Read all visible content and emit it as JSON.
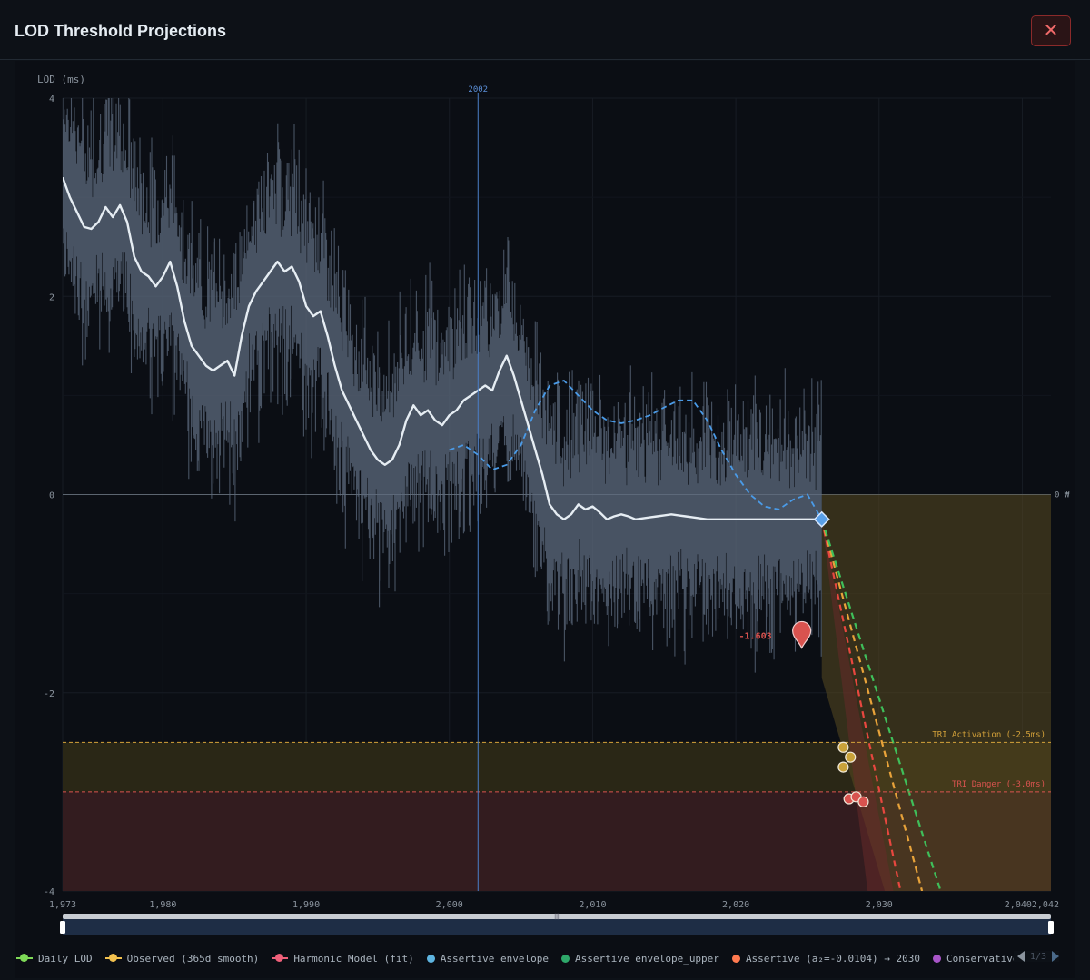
{
  "header": {
    "title": "LOD Threshold Projections",
    "close_icon": "close-icon",
    "close_color": "#f06a6a"
  },
  "chart_data": {
    "type": "line",
    "ylabel": "LOD (ms)",
    "xlim": [
      1973,
      2042
    ],
    "ylim": [
      -4,
      4
    ],
    "x_ticks": [
      "1,973",
      "1,980",
      "1,990",
      "2,000",
      "2,010",
      "2,020",
      "2,030",
      "2,0402,042"
    ],
    "x_tick_values": [
      1973,
      1980,
      1990,
      2000,
      2010,
      2020,
      2030,
      2040
    ],
    "y_ticks": [
      "4",
      "2",
      "0",
      "-2",
      "-4"
    ],
    "y_tick_values": [
      4,
      2,
      0,
      -2,
      -4
    ],
    "grid": true,
    "zero_line_label": "0 ₩",
    "vertical_marker": {
      "x": 2002,
      "label": "2002",
      "color": "#4a7fc8"
    },
    "thresholds": [
      {
        "name": "TRI Activation (-2.5ms)",
        "y": -2.5,
        "color": "#d4a23a",
        "band_color": "#2a2716"
      },
      {
        "name": "TRI Danger (-3.0ms)",
        "y": -3.0,
        "color": "#d9534f",
        "band_color": "#331c1f"
      }
    ],
    "min_marker": {
      "x": 2024.6,
      "y": -1.42,
      "label": "-1.603",
      "color": "#d9534f"
    },
    "projection_start": {
      "x": 2026.0,
      "y": -0.25
    },
    "series": [
      {
        "name": "Daily LOD",
        "legend_color": "#7ed957",
        "color": "#5d6b7d"
      },
      {
        "name": "Observed (365d smooth)",
        "legend_color": "#f2c14e",
        "color": "#e6edf3",
        "x": [
          1973.0,
          1973.5,
          1974,
          1974.5,
          1975,
          1975.5,
          1976,
          1976.5,
          1977,
          1977.5,
          1978,
          1978.5,
          1979,
          1979.5,
          1980,
          1980.5,
          1981,
          1981.5,
          1982,
          1982.5,
          1983,
          1983.5,
          1984,
          1984.5,
          1985,
          1985.5,
          1986,
          1986.5,
          1987,
          1987.5,
          1988,
          1988.5,
          1989,
          1989.5,
          1990,
          1990.5,
          1991,
          1991.5,
          1992,
          1992.5,
          1993,
          1993.5,
          1994,
          1994.5,
          1995,
          1995.5,
          1996,
          1996.5,
          1997,
          1997.5,
          1998,
          1998.5,
          1999,
          1999.5,
          2000,
          2000.5,
          2001,
          2001.5,
          2002,
          2002.5,
          2003,
          2003.5,
          2004,
          2004.5,
          2005,
          2005.5,
          2006,
          2006.5,
          2007,
          2007.5,
          2008,
          2008.5,
          2009,
          2009.5,
          2010,
          2010.5,
          2011,
          2011.5,
          2012,
          2012.5,
          2013,
          2013.5,
          2014,
          2014.5,
          2015,
          2015.5,
          2016,
          2016.5,
          2017,
          2017.5,
          2018,
          2018.5,
          2019,
          2019.5,
          2020,
          2020.5,
          2021,
          2021.5,
          2022,
          2022.5,
          2023,
          2023.5,
          2024,
          2024.5,
          2025,
          2025.5,
          2026
        ],
        "y": [
          3.2,
          3.0,
          2.85,
          2.7,
          2.68,
          2.75,
          2.9,
          2.8,
          2.92,
          2.75,
          2.4,
          2.25,
          2.2,
          2.1,
          2.2,
          2.35,
          2.1,
          1.75,
          1.5,
          1.4,
          1.3,
          1.25,
          1.3,
          1.35,
          1.2,
          1.6,
          1.9,
          2.05,
          2.15,
          2.25,
          2.35,
          2.25,
          2.3,
          2.15,
          1.9,
          1.8,
          1.85,
          1.6,
          1.3,
          1.05,
          0.9,
          0.75,
          0.6,
          0.45,
          0.35,
          0.3,
          0.35,
          0.5,
          0.75,
          0.9,
          0.8,
          0.85,
          0.75,
          0.7,
          0.8,
          0.85,
          0.95,
          1.0,
          1.05,
          1.1,
          1.05,
          1.25,
          1.4,
          1.2,
          0.95,
          0.7,
          0.45,
          0.2,
          -0.1,
          -0.2,
          -0.25,
          -0.2,
          -0.1,
          -0.15,
          -0.12,
          -0.18,
          -0.25,
          -0.22,
          -0.2,
          -0.22,
          -0.25,
          -0.24,
          -0.23,
          -0.22,
          -0.21,
          -0.2,
          -0.21,
          -0.22,
          -0.23,
          -0.24,
          -0.25,
          -0.25,
          -0.25,
          -0.25,
          -0.25,
          -0.25,
          -0.25,
          -0.25,
          -0.25,
          -0.25,
          -0.25,
          -0.25,
          -0.25,
          -0.25,
          -0.25,
          -0.25,
          -0.25
        ]
      },
      {
        "name": "Harmonic Model (fit)",
        "legend_color": "#f0607a",
        "color": "#4a9be8",
        "x": [
          2000,
          2001,
          2002,
          2003,
          2004,
          2005,
          2006,
          2007,
          2008,
          2009,
          2010,
          2011,
          2012,
          2013,
          2014,
          2015,
          2016,
          2017,
          2018,
          2019,
          2020,
          2021,
          2022,
          2023,
          2024,
          2025,
          2026
        ],
        "y": [
          0.45,
          0.5,
          0.4,
          0.25,
          0.3,
          0.5,
          0.85,
          1.1,
          1.15,
          1.0,
          0.85,
          0.75,
          0.72,
          0.75,
          0.8,
          0.88,
          0.95,
          0.95,
          0.75,
          0.45,
          0.2,
          0.0,
          -0.12,
          -0.15,
          -0.05,
          0.0,
          -0.25
        ]
      },
      {
        "name": "Assertive envelope",
        "legend_color": "#5eb4e0"
      },
      {
        "name": "Assertive envelope_upper",
        "legend_color": "#2ea86a"
      },
      {
        "name": "Assertive (a₂=-0.0104) → 2030",
        "legend_color": "#ff7a50"
      },
      {
        "name": "Conservative en",
        "legend_color": "#a855c8"
      }
    ],
    "projections": [
      {
        "color": "#e8473f",
        "x": [
          2026.0,
          2031.5
        ],
        "y": [
          -0.25,
          -4.0
        ]
      },
      {
        "color": "#e8a33a",
        "x": [
          2026.0,
          2033.0
        ],
        "y": [
          -0.25,
          -4.0
        ]
      },
      {
        "color": "#3fbf5a",
        "x": [
          2026.0,
          2034.3
        ],
        "y": [
          -0.25,
          -4.0
        ]
      }
    ],
    "crossing_markers": [
      {
        "color": "#c9a23a",
        "points": [
          [
            2027.5,
            -2.55
          ],
          [
            2028.0,
            -2.65
          ],
          [
            2027.5,
            -2.75
          ]
        ]
      },
      {
        "color": "#d9534f",
        "points": [
          [
            2027.9,
            -3.07
          ],
          [
            2028.4,
            -3.05
          ],
          [
            2028.9,
            -3.1
          ]
        ]
      }
    ]
  },
  "legend_pager": {
    "text": "1/3"
  }
}
